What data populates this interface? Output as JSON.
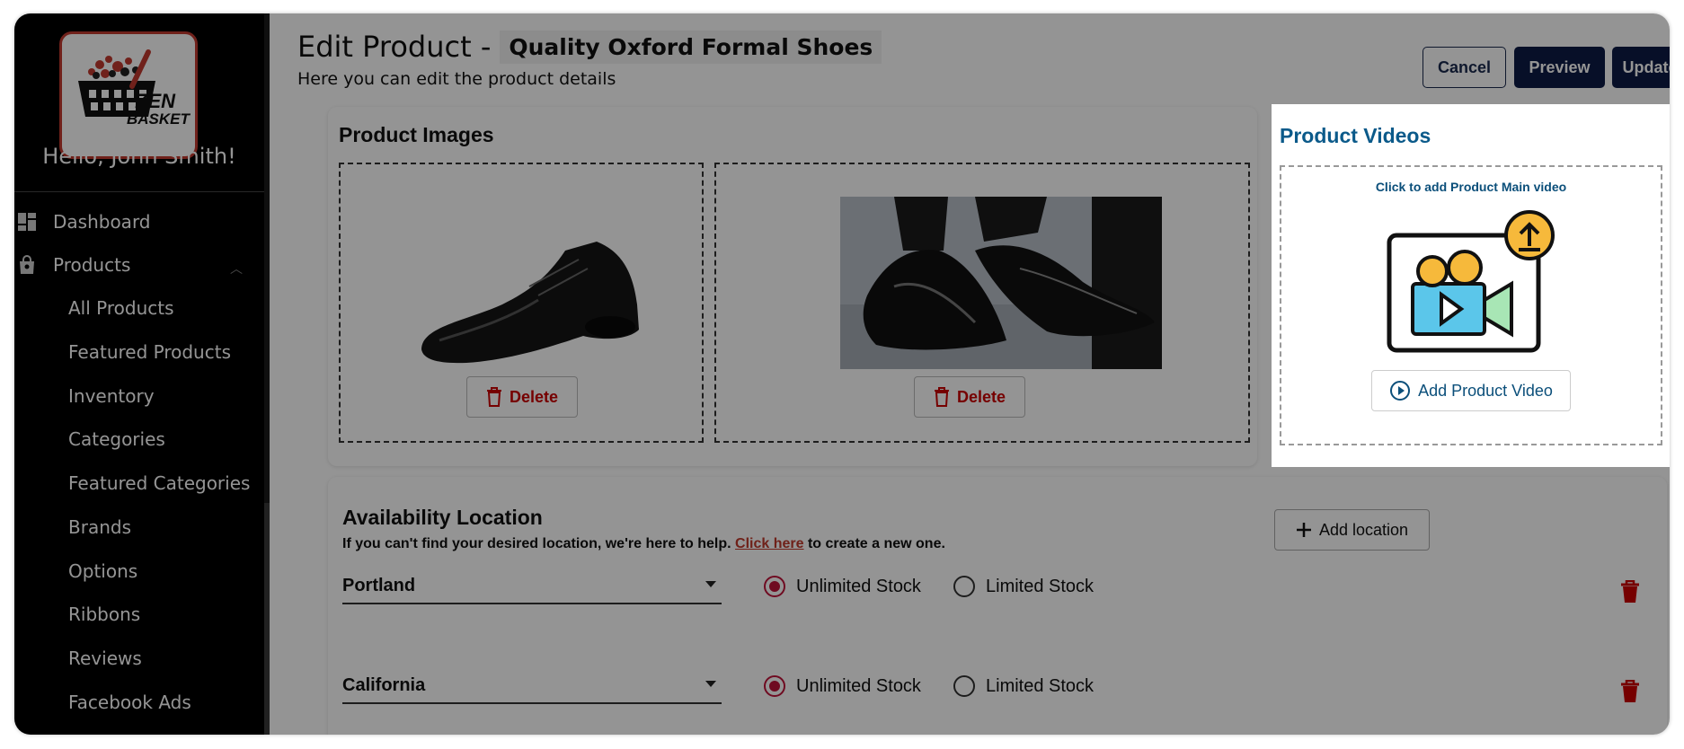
{
  "sidebar": {
    "brand_line1": "ZEN",
    "brand_line2": "BASKET",
    "greeting": "Hello, John Smith!",
    "items": [
      {
        "label": "Dashboard",
        "icon": "dashboard-icon"
      },
      {
        "label": "Products",
        "icon": "shopping-bag-icon"
      },
      {
        "label": "All Products"
      },
      {
        "label": "Featured Products"
      },
      {
        "label": "Inventory"
      },
      {
        "label": "Categories"
      },
      {
        "label": "Featured Categories"
      },
      {
        "label": "Brands"
      },
      {
        "label": "Options"
      },
      {
        "label": "Ribbons"
      },
      {
        "label": "Reviews"
      },
      {
        "label": "Facebook Ads"
      }
    ]
  },
  "header": {
    "title_prefix": "Edit Product -",
    "product_name": "Quality Oxford Formal Shoes",
    "subtitle": "Here you can edit the product details",
    "cancel_label": "Cancel",
    "preview_label": "Preview",
    "update_label": "Update"
  },
  "images_card": {
    "title": "Product Images",
    "delete_label": "Delete"
  },
  "videos_card": {
    "title": "Product Videos",
    "hint": "Click to add Product Main video",
    "add_label": "Add Product Video"
  },
  "availability": {
    "title": "Availability Location",
    "help_prefix": "If you can't find your desired location, we're here to help.",
    "help_link": "Click here",
    "help_suffix": " to create a new one.",
    "add_location_label": "Add location",
    "unlimited_label": "Unlimited Stock",
    "limited_label": "Limited Stock",
    "locations": [
      {
        "name": "Portland",
        "stock": "unlimited"
      },
      {
        "name": "California",
        "stock": "unlimited"
      }
    ]
  },
  "colors": {
    "navy": "#0d1a45",
    "danger": "#c00000",
    "link": "#0b5a8a",
    "radio_on": "#c0133a"
  }
}
